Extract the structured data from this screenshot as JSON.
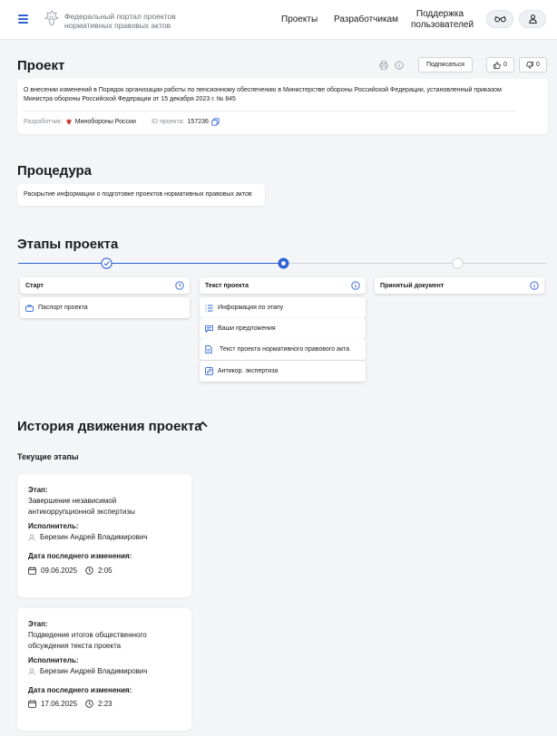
{
  "header": {
    "portal_title": "Федеральный портал проектов нормативных правовых актов",
    "nav": {
      "projects": "Проекты",
      "developers": "Разработчикам",
      "support": "Поддержка пользователей"
    },
    "icons": [
      "menu-icon",
      "emblem-icon",
      "glasses-icon",
      "user-icon"
    ]
  },
  "project": {
    "heading": "Проект",
    "subscribe_label": "Подписаться",
    "likes": "0",
    "dislikes": "0",
    "description": "О внесении изменений в Порядок организации работы по пенсионному обеспечению в Министерстве обороны Российской Федерации, установленный приказом Министра обороны Российской Федерации от 15 декабря 2023 г. № 845",
    "developer_label": "Разработчик:",
    "developer_value": "Минобороны России",
    "id_label": "ID проекта:",
    "id_value": "157236"
  },
  "procedure": {
    "heading": "Процедура",
    "text": "Раскрытие информации о подготовке проектов нормативных правовых актов"
  },
  "stages": {
    "heading": "Этапы проекта",
    "columns": [
      {
        "title": "Старт",
        "status": "done",
        "items": [
          {
            "icon": "briefcase-icon",
            "label": "Паспорт проекта"
          }
        ]
      },
      {
        "title": "Текст проекта",
        "status": "current",
        "items": [
          {
            "icon": "list-icon",
            "label": "Информация по этапу"
          },
          {
            "icon": "comment-icon",
            "label": "Ваши предложения"
          },
          {
            "icon": "document-icon",
            "label": "Текст проекта нормативного правового акта"
          },
          {
            "icon": "edit-icon",
            "label": "Антикор. экспертиза"
          }
        ]
      },
      {
        "title": "Принятый документ",
        "status": "upcoming",
        "items": []
      }
    ],
    "accent_color": "#2f61d5"
  },
  "history": {
    "heading": "История движения проекта",
    "current_label": "Текущие этапы",
    "stage_label": "Этап:",
    "executor_label": "Исполнитель:",
    "date_label": "Дата последнего изменения:",
    "items": [
      {
        "stage": "Завершение независимой антикоррупционной экспертизы",
        "executor": "Березин Андрей Владимирович",
        "date": "09.06.2025",
        "time": "2:05"
      },
      {
        "stage": "Подведение итогов общественного обсуждения текста проекта",
        "executor": "Березин Андрей Владимирович",
        "date": "17.06.2025",
        "time": "2:23"
      }
    ]
  }
}
